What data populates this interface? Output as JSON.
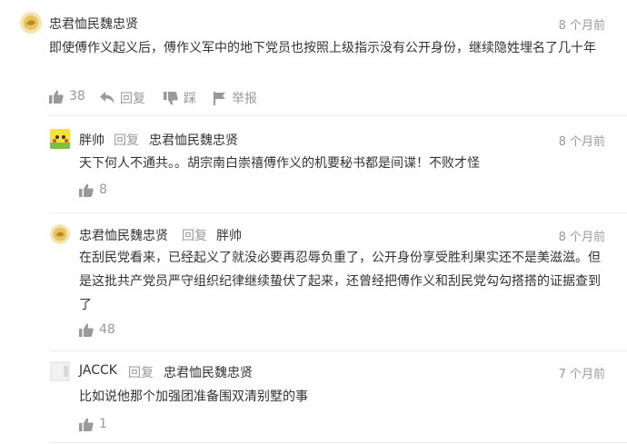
{
  "comment": {
    "user": "忠君恤民魏忠贤",
    "time": "8 个月前",
    "text": "即使傅作义起义后，傅作义军中的地下党员也按照上级指示没有公开身份，继续隐姓埋名了几十年",
    "likes": "38",
    "reply_label": "回复",
    "dislike_label": "踩",
    "report_label": "举报"
  },
  "replies": [
    {
      "user": "胖帅",
      "reply_word": "回复",
      "reply_to": "忠君恤民魏忠贤",
      "time": "8 个月前",
      "text": "天下何人不通共。。胡宗南白崇禧傅作义的机要秘书都是间谍！不败才怪",
      "likes": "8"
    },
    {
      "user": "忠君恤民魏忠贤",
      "reply_word": "回复",
      "reply_to": "胖帅",
      "time": "8 个月前",
      "text": "在刮民党看来，已经起义了就没必要再忍辱负重了，公开身份享受胜利果实还不是美滋滋。但是这批共产党员严守组织纪律继续蛰伏了起来，还曾经把傅作义和刮民党勾勾搭搭的证据查到了",
      "likes": "48"
    },
    {
      "user": "JACCK",
      "reply_word": "回复",
      "reply_to": "忠君恤民魏忠贤",
      "time": "7 个月前",
      "text": "比如说他那个加强团准备围双清别墅的事",
      "likes": "1"
    }
  ],
  "colors": {
    "text": "#333333",
    "muted": "#999999",
    "divider": "#ececec",
    "avatar_gold": "#e8c25a"
  }
}
